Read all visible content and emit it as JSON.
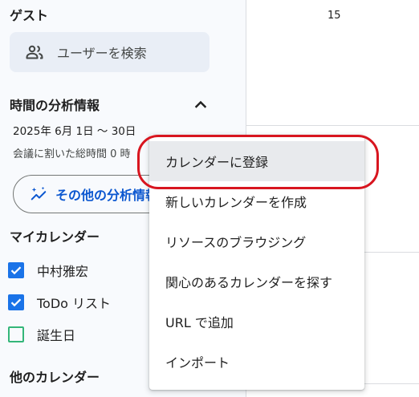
{
  "sidebar": {
    "guest_title": "ゲスト",
    "user_search": {
      "icon": "people-icon",
      "label": "ユーザーを検索"
    },
    "time_insights": {
      "title": "時間の分析情報",
      "toggle_icon": "chevron-up-icon",
      "date_range": "2025年 6月 1日 〜 30日",
      "meeting_total": "会議に割いた総時間 0 時",
      "more_button": {
        "icon": "sparkle-chart-icon",
        "label": "その他の分析情報"
      }
    },
    "my_calendars": {
      "title": "マイカレンダー",
      "items": [
        {
          "label": "中村雅宏",
          "checked": true,
          "color": "#1a73e8"
        },
        {
          "label": "ToDo リスト",
          "checked": true,
          "color": "#1a73e8"
        },
        {
          "label": "誕生日",
          "checked": false,
          "color": "#33b679"
        }
      ]
    },
    "other_calendars": {
      "title": "他のカレンダー"
    }
  },
  "main": {
    "day_number": "15"
  },
  "menu": {
    "items": [
      {
        "label": "カレンダーに登録",
        "highlighted": true
      },
      {
        "label": "新しいカレンダーを作成"
      },
      {
        "label": "リソースのブラウジング"
      },
      {
        "label": "関心のあるカレンダーを探す"
      },
      {
        "label": "URL で追加"
      },
      {
        "label": "インポート"
      }
    ]
  },
  "colors": {
    "accent": "#0b57d0",
    "checkbox_blue": "#1a73e8",
    "highlight_red": "#d8151f",
    "sidebar_bg": "#f8fafd"
  }
}
